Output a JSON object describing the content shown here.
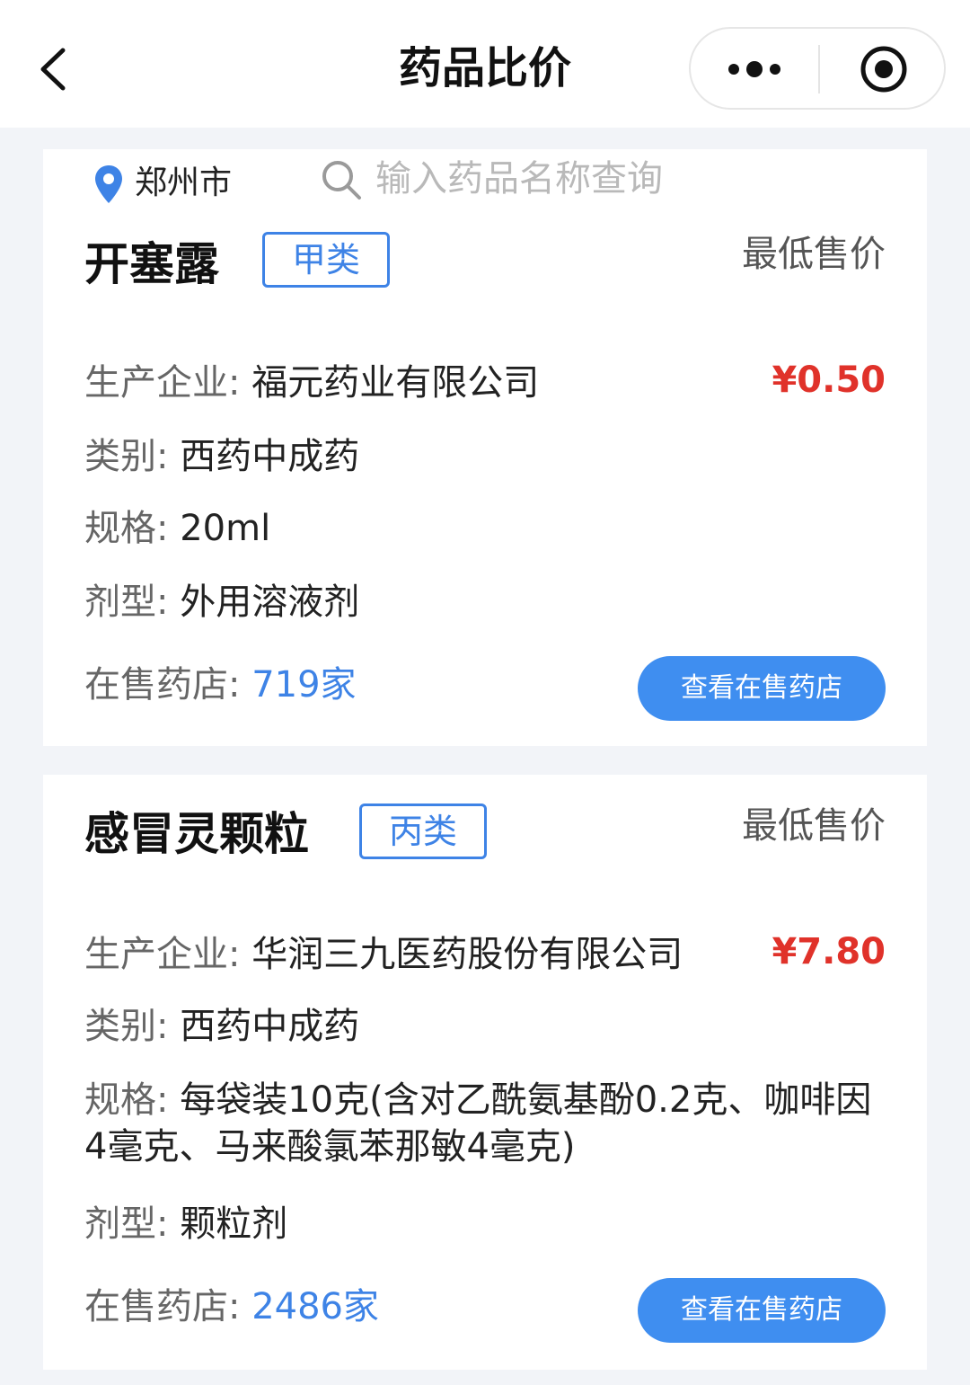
{
  "header": {
    "title": "药品比价"
  },
  "location": {
    "city": "郑州市"
  },
  "search": {
    "placeholder": "输入药品名称查询"
  },
  "drugs": [
    {
      "name": "开塞露",
      "category_badge": "甲类",
      "lowest_price_label": "最低售价",
      "price": "¥0.50",
      "manufacturer_label": "生产企业:",
      "manufacturer": "福元药业有限公司",
      "type_label": "类别:",
      "type": "西药中成药",
      "spec_label": "规格:",
      "spec": "20ml",
      "form_label": "剂型:",
      "form": "外用溶液剂",
      "stores_label": "在售药店:",
      "stores": "719家",
      "button": "查看在售药店"
    },
    {
      "name": "感冒灵颗粒",
      "category_badge": "丙类",
      "lowest_price_label": "最低售价",
      "price": "¥7.80",
      "manufacturer_label": "生产企业:",
      "manufacturer": "华润三九医药股份有限公司",
      "type_label": "类别:",
      "type": "西药中成药",
      "spec_label": "规格:",
      "spec": "每袋装10克(含对乙酰氨基酚0.2克、咖啡因4毫克、马来酸氯苯那敏4毫克)",
      "form_label": "剂型:",
      "form": "颗粒剂",
      "stores_label": "在售药店:",
      "stores": "2486家",
      "button": "查看在售药店"
    }
  ],
  "colors": {
    "accent": "#3e83e6",
    "price": "#e0322a",
    "button": "#3f8ef0"
  }
}
